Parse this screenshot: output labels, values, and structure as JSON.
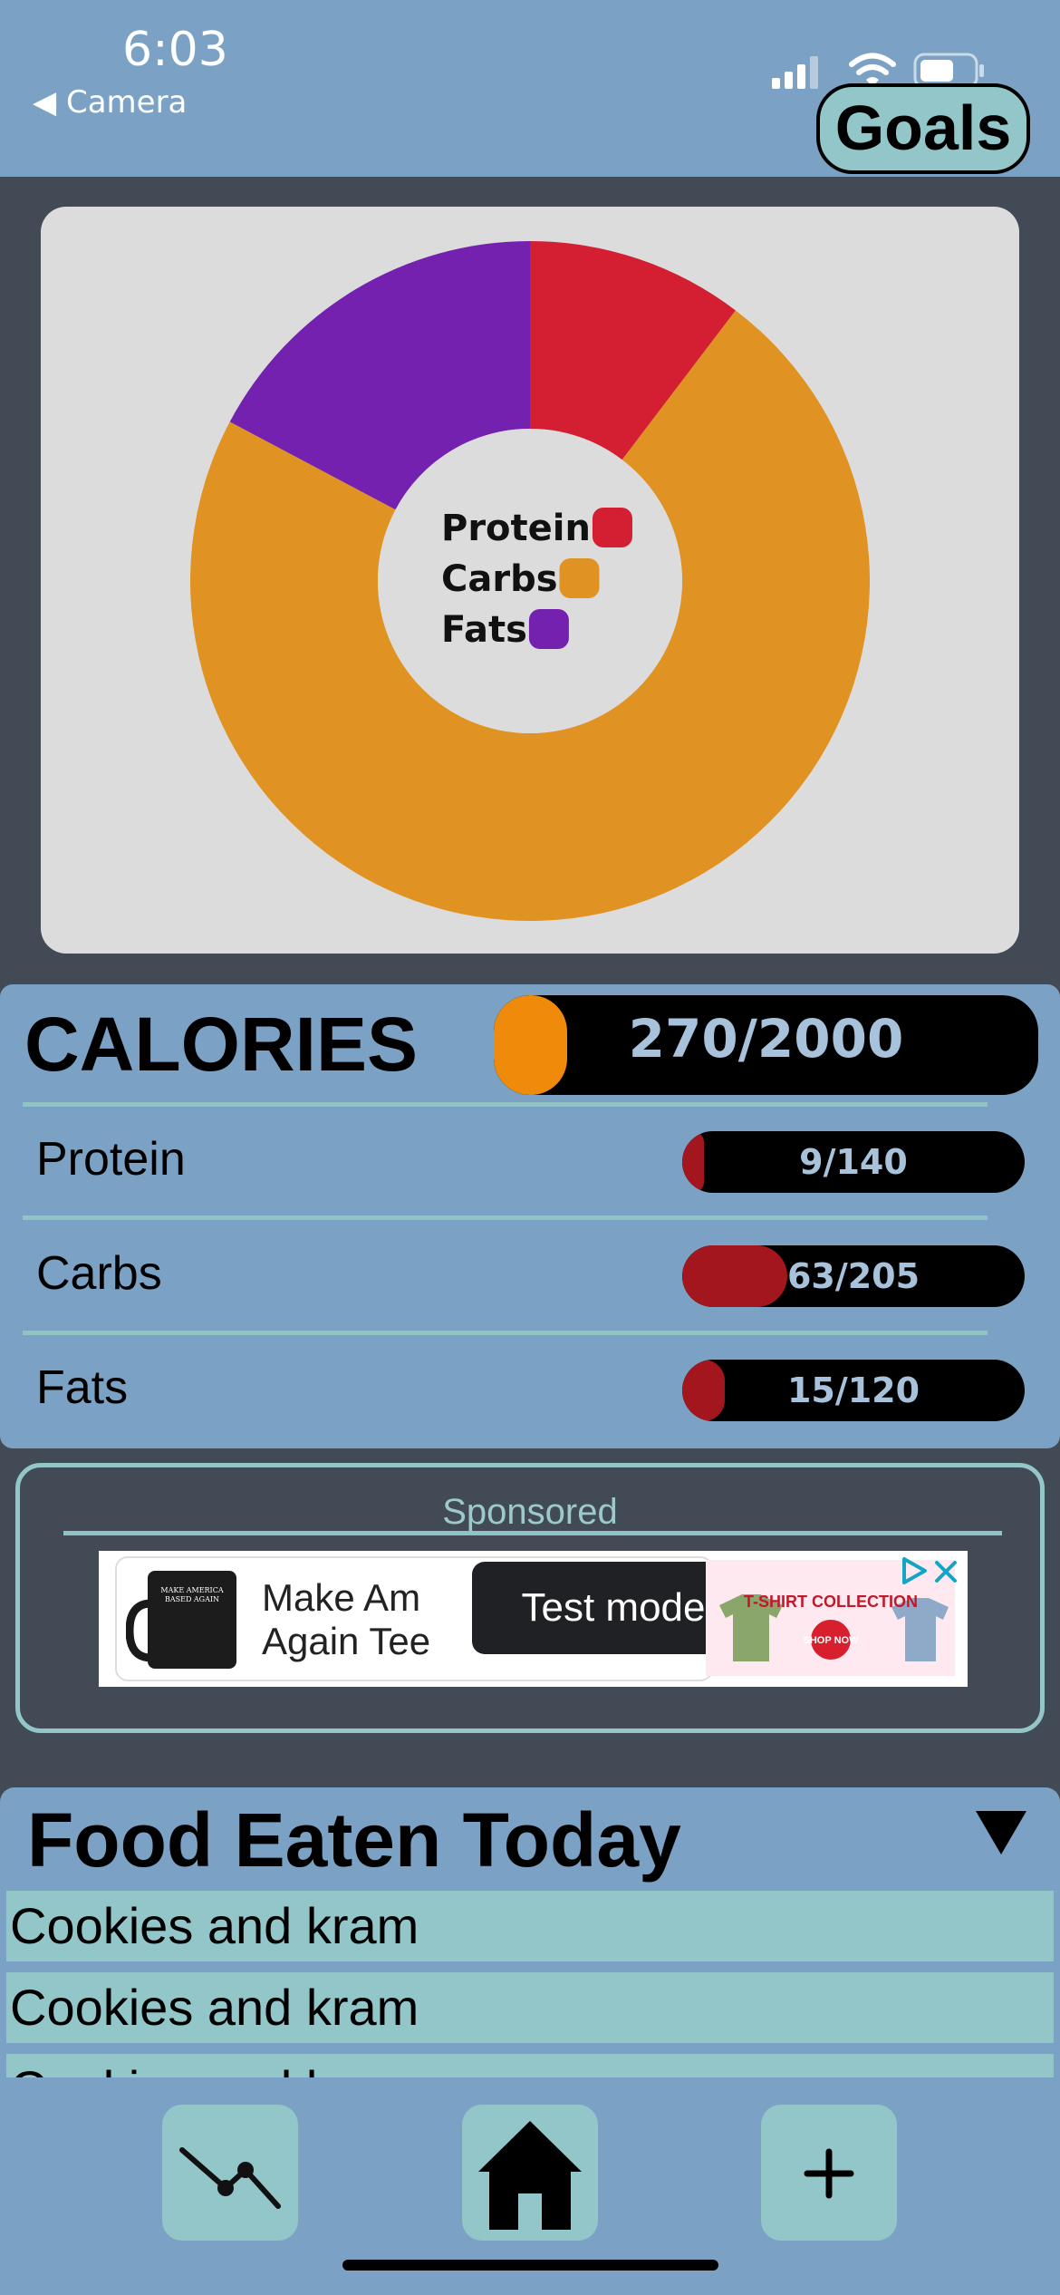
{
  "status_bar": {
    "time": "6:03",
    "back_label": "◀ Camera"
  },
  "header": {
    "goals_label": "Goals"
  },
  "chart_data": {
    "type": "pie",
    "donut": true,
    "categories": [
      "Protein",
      "Carbs",
      "Fats"
    ],
    "values": [
      9,
      63,
      15
    ],
    "colors": [
      "#d41f32",
      "#e09222",
      "#7521b0"
    ],
    "legend": "center"
  },
  "macros": {
    "calories": {
      "label": "CALORIES",
      "value": "270/2000",
      "fraction": 0.135,
      "color": "#f08a0a"
    },
    "items": [
      {
        "label": "Protein",
        "value": "9/140",
        "fraction": 0.064,
        "color": "#a3161e"
      },
      {
        "label": "Carbs",
        "value": "63/205",
        "fraction": 0.307,
        "color": "#a3161e"
      },
      {
        "label": "Fats",
        "value": "15/120",
        "fraction": 0.125,
        "color": "#a3161e"
      }
    ]
  },
  "ad": {
    "sponsored_label": "Sponsored",
    "line1": "Make Am",
    "line2": "Again Tee",
    "test_mode": "Test mode",
    "mug_text": "MAKE AMERICA BASED AGAIN",
    "ribbon_text": "T-SHIRT COLLECTION",
    "shop_text": "SHOP NOW"
  },
  "food": {
    "title": "Food Eaten Today",
    "items": [
      "Cookies and kram",
      "Cookies and kram",
      "Cookies and kram"
    ]
  },
  "icons": {
    "back": "back-arrow-icon",
    "signal": "signal-icon",
    "wifi": "wifi-icon",
    "battery": "battery-icon",
    "collapse": "triangle-down-icon",
    "trend": "trend-chart-icon",
    "home": "home-icon",
    "add": "plus-icon"
  }
}
